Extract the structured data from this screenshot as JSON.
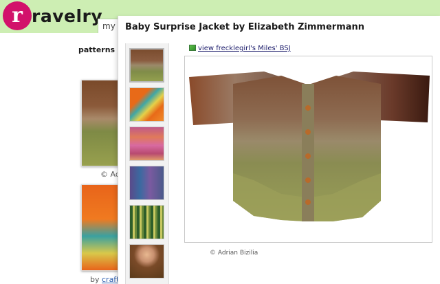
{
  "header": {
    "logo_text": "ravelry",
    "logo_initial": "r",
    "nav_stub": "my n"
  },
  "breadcrumb": {
    "first": "patterns",
    "separator": ">"
  },
  "background_results": [
    {
      "caption": "© Adr"
    },
    {
      "caption_prefix": "by",
      "caption_link": "craftiv"
    }
  ],
  "modal": {
    "title": "Baby Surprise Jacket by Elizabeth Zimmermann",
    "view_link": "view frecklegirl's Miles' BSJ",
    "photo_credit": "© Adrian Bizilia",
    "thumbnails": [
      {
        "name": "thumb-striped-brown-green",
        "selected": true
      },
      {
        "name": "thumb-orange-teal"
      },
      {
        "name": "thumb-pink-multicolor"
      },
      {
        "name": "thumb-purple-blue"
      },
      {
        "name": "thumb-green-stripes"
      },
      {
        "name": "thumb-child-photo"
      }
    ]
  },
  "colors": {
    "header_band": "#cdeeb3",
    "logo_accent": "#d2116b",
    "link": "#1a1a6a"
  }
}
